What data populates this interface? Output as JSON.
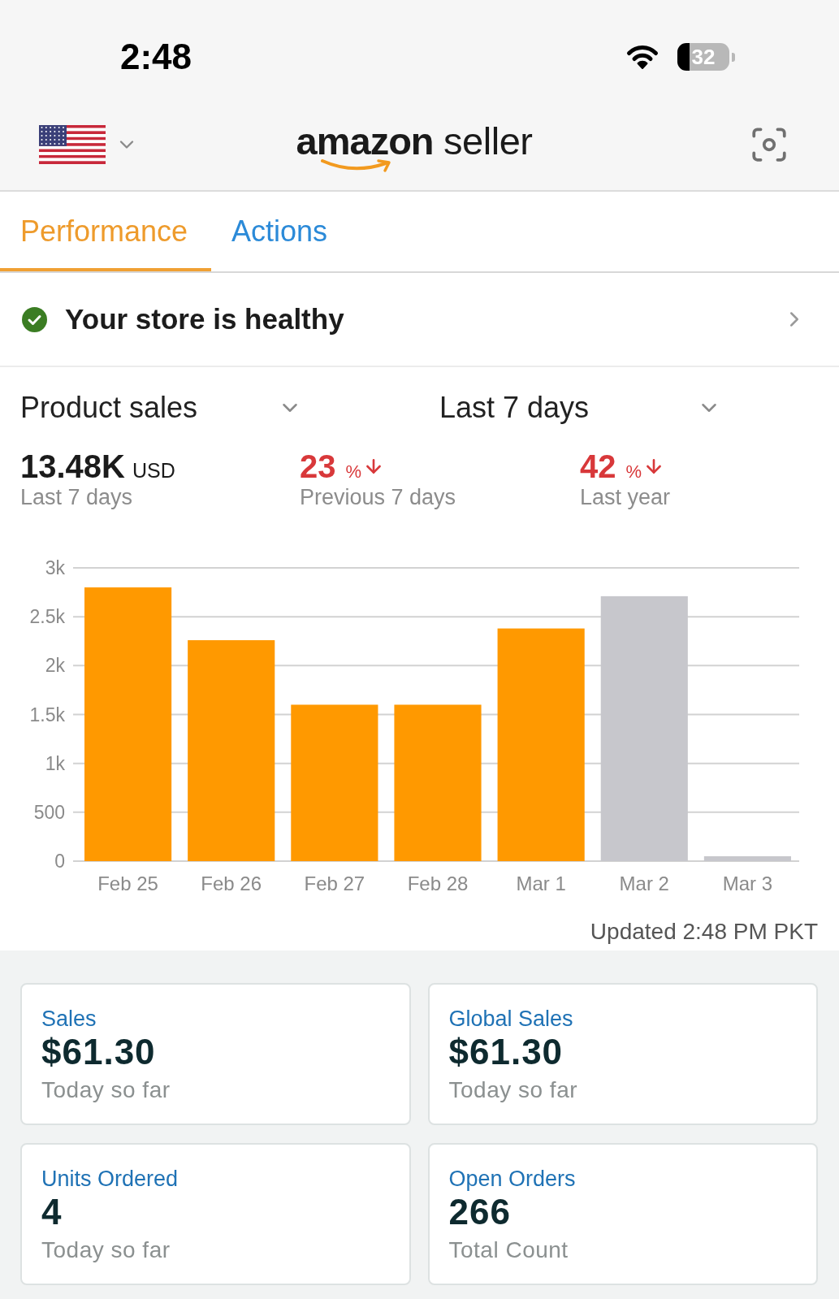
{
  "status_bar": {
    "time": "2:48",
    "battery": "32"
  },
  "header": {
    "logo": "**amazon** seller"
  },
  "tabs": [
    {
      "label": "Performance",
      "selected": true
    },
    {
      "label": "Actions",
      "selected": false
    }
  ],
  "store_status": {
    "kind": "healthy",
    "text": "Your store is healthy"
  },
  "filters": [
    {
      "label": "Product sales"
    },
    {
      "label": "Last 7 days"
    }
  ],
  "stats": [
    {
      "kind": "total",
      "value": "13.48K",
      "unit": "USD",
      "caption": "Last 7 days"
    },
    {
      "kind": "change",
      "value": "23",
      "unit": "%",
      "decline": true,
      "caption": "Previous 7 days"
    },
    {
      "kind": "change",
      "value": "42",
      "unit": "%",
      "decline": true,
      "caption": "Last year"
    }
  ],
  "sales_chart": {
    "chart_data": {
      "type": "bar",
      "categories": [
        "Feb 25",
        "Feb 26",
        "Feb 27",
        "Feb 28",
        "Mar 1",
        "Mar 2",
        "Mar 3"
      ],
      "series": [
        {
          "color": "#ff9900",
          "values": [
            2800,
            2260,
            1600,
            1600,
            2380,
            null,
            null
          ]
        },
        {
          "color": "#c7c7cc",
          "values": [
            null,
            null,
            null,
            null,
            null,
            2710,
            50
          ]
        }
      ],
      "stacked": true,
      "grid": true,
      "ylim": [
        0,
        3000
      ],
      "yticks": [
        {
          "value": 0,
          "label": "0"
        },
        {
          "value": 500,
          "label": "500"
        },
        {
          "value": 1000,
          "label": "1k"
        },
        {
          "value": 1500,
          "label": "1.5k"
        },
        {
          "value": 2000,
          "label": "2k"
        },
        {
          "value": 2500,
          "label": "2.5k"
        },
        {
          "value": 3000,
          "label": "3k"
        }
      ]
    },
    "updated": "Updated 2:48 PM PKT"
  },
  "cards": [
    {
      "label": "Sales",
      "value": "$61.30",
      "caption": "Today so far"
    },
    {
      "label": "Global Sales",
      "value": "$61.30",
      "caption": "Today so far"
    },
    {
      "label": "Units Ordered",
      "value": "4",
      "caption": "Today so far"
    },
    {
      "label": "Open Orders",
      "value": "266",
      "caption": "Total Count"
    }
  ]
}
